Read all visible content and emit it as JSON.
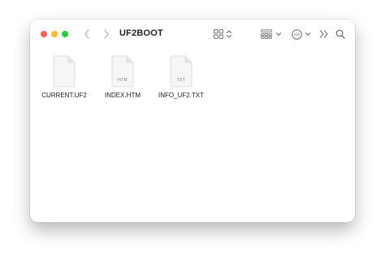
{
  "window": {
    "title": "UF2BOOT"
  },
  "icons": {
    "back": "chevron-left-icon",
    "forward": "chevron-right-icon",
    "view": "grid-view-icon",
    "group": "group-by-icon",
    "more": "ellipsis-circle-icon",
    "extend": "double-chevron-right-icon",
    "search": "magnifying-glass-icon"
  },
  "colors": {
    "close": "#fe5f57",
    "minimize": "#febc2e",
    "maximize": "#28c840"
  },
  "files": [
    {
      "name": "CURRENT.UF2",
      "ext": ""
    },
    {
      "name": "INDEX.HTM",
      "ext": "HTM"
    },
    {
      "name": "INFO_UF2.TXT",
      "ext": "TXT"
    }
  ]
}
